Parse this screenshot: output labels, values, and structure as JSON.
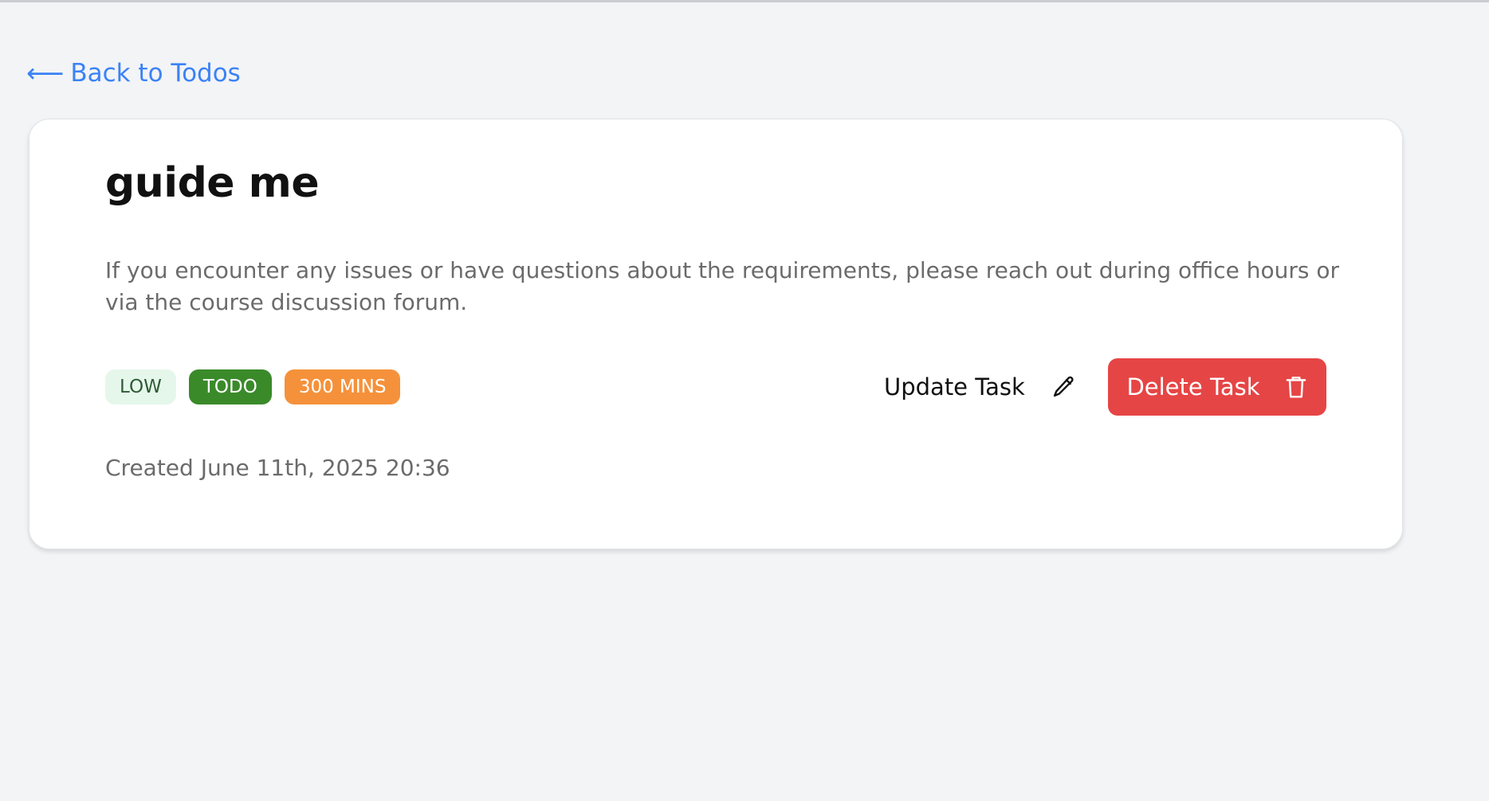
{
  "nav": {
    "back_arrow": "⟵",
    "back_label": "Back to Todos"
  },
  "task": {
    "title": "guide me",
    "description": "If you encounter any issues or have questions about the requirements, please reach out during office hours or via the course discussion forum.",
    "priority_badge": "LOW",
    "status_badge": "TODO",
    "duration_badge": "300 MINS",
    "created": "Created June 11th, 2025 20:36"
  },
  "actions": {
    "update_label": "Update Task",
    "update_icon": "pencil-icon",
    "delete_label": "Delete Task",
    "delete_icon": "trash-icon"
  },
  "colors": {
    "accent_link": "#3b82f6",
    "delete_button": "#e64545",
    "status_badge": "#3a8a2a",
    "duration_badge": "#f5913a",
    "priority_badge_bg": "#e5f7ea"
  }
}
